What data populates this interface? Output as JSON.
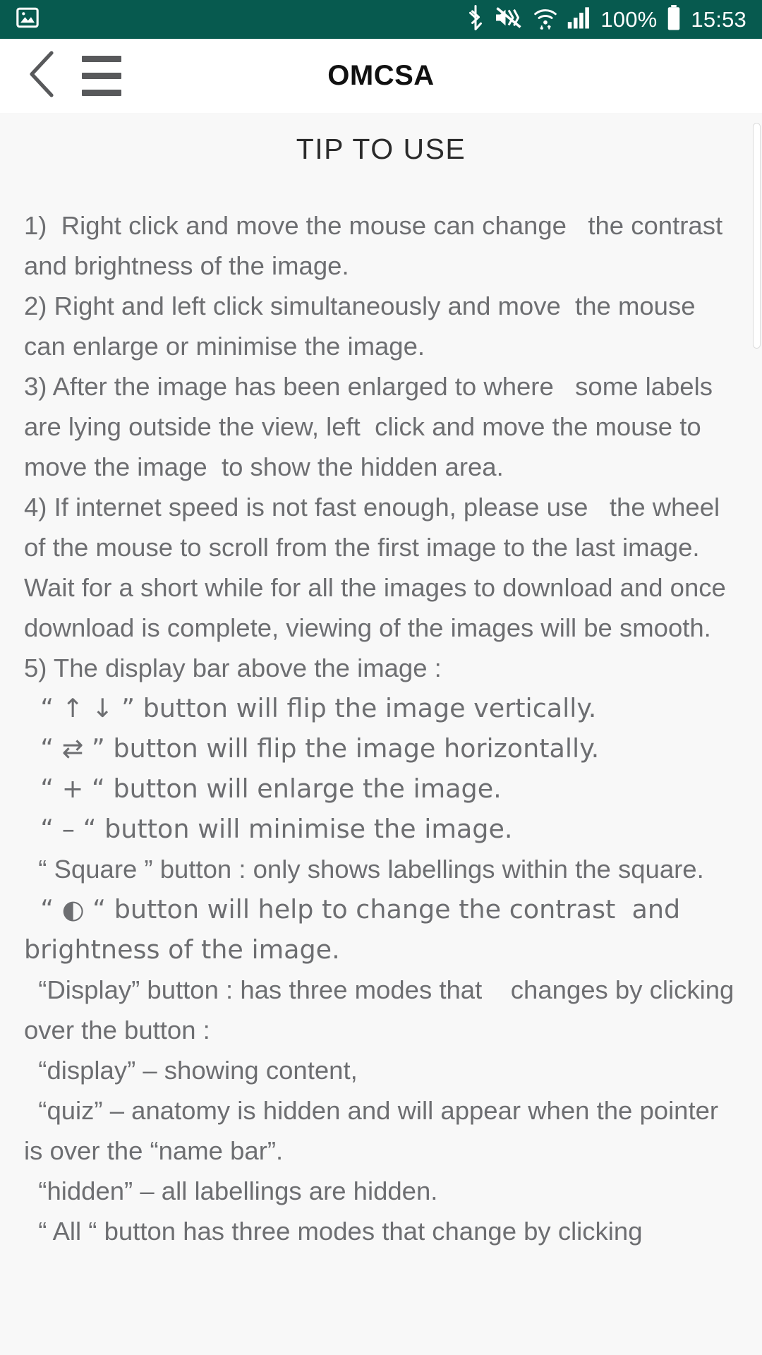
{
  "status_bar": {
    "background": "#075A4F",
    "left_icons": [
      "image-icon"
    ],
    "right_icons": [
      "bluetooth-icon",
      "mute-vibrate-icon",
      "wifi-icon",
      "signal-icon",
      "battery-icon"
    ],
    "battery_percent": "100%",
    "time": "15:53"
  },
  "app_bar": {
    "back_label": "back-chevron",
    "menu_label": "hamburger-menu",
    "title": "OMCSA"
  },
  "content": {
    "heading": "TIP TO USE",
    "text_color": "#6d6e71",
    "background": "#f8f8f8",
    "tips": [
      "1)  Right click and move the mouse can change   the contrast and brightness of the image.",
      "2) Right and left click simultaneously and move  the mouse can enlarge or minimise the image.",
      "3) After the image has been enlarged to where   some labels are lying outside the view, left  click and move the mouse to move the image  to show the hidden area.",
      "4) If internet speed is not fast enough, please use   the wheel of the mouse to scroll from the first image to the last image. Wait for a short while for all the images to download and once    download is complete, viewing of the images will be smooth.",
      "5) The display bar above the image :",
      "  “ ↑ ↓ ” button will flip the image vertically.",
      "  “ ⇄ ” button will flip the image horizontally.",
      "  “ + “ button will enlarge the image.",
      "  “ – “ button will minimise the image.",
      "  “ Square ” button : only shows labellings within the square.",
      "  “ ◐ “ button will help to change the contrast  and brightness of the image.",
      "  “Display” button : has three modes that    changes by clicking over the button :",
      "  “display” – showing content,",
      "  “quiz” – anatomy is hidden and will appear when the pointer is over the “name bar”.",
      "  “hidden” – all labellings are hidden.",
      "  “ All “ button has three modes that change by clicking"
    ]
  }
}
